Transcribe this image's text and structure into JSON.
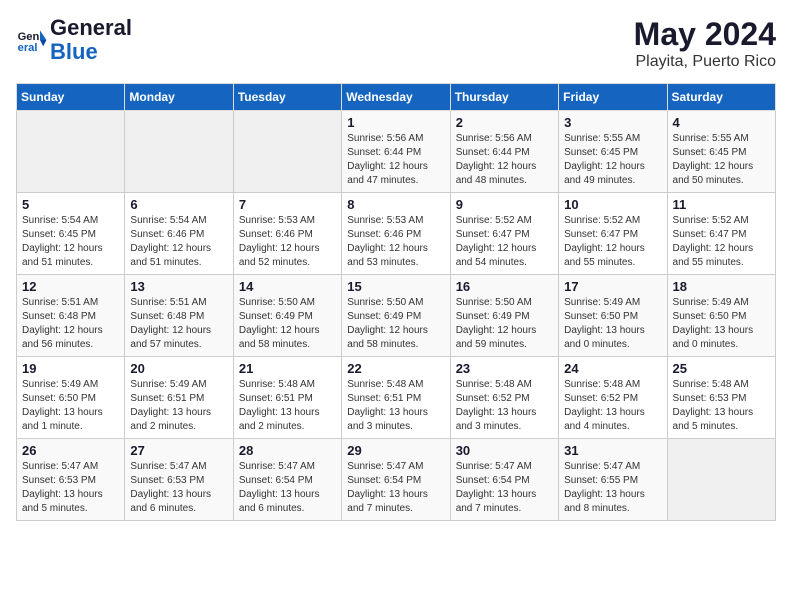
{
  "header": {
    "logo_general": "General",
    "logo_blue": "Blue",
    "month": "May 2024",
    "location": "Playita, Puerto Rico"
  },
  "days_of_week": [
    "Sunday",
    "Monday",
    "Tuesday",
    "Wednesday",
    "Thursday",
    "Friday",
    "Saturday"
  ],
  "weeks": [
    [
      {
        "day": "",
        "info": ""
      },
      {
        "day": "",
        "info": ""
      },
      {
        "day": "",
        "info": ""
      },
      {
        "day": "1",
        "info": "Sunrise: 5:56 AM\nSunset: 6:44 PM\nDaylight: 12 hours\nand 47 minutes."
      },
      {
        "day": "2",
        "info": "Sunrise: 5:56 AM\nSunset: 6:44 PM\nDaylight: 12 hours\nand 48 minutes."
      },
      {
        "day": "3",
        "info": "Sunrise: 5:55 AM\nSunset: 6:45 PM\nDaylight: 12 hours\nand 49 minutes."
      },
      {
        "day": "4",
        "info": "Sunrise: 5:55 AM\nSunset: 6:45 PM\nDaylight: 12 hours\nand 50 minutes."
      }
    ],
    [
      {
        "day": "5",
        "info": "Sunrise: 5:54 AM\nSunset: 6:45 PM\nDaylight: 12 hours\nand 51 minutes."
      },
      {
        "day": "6",
        "info": "Sunrise: 5:54 AM\nSunset: 6:46 PM\nDaylight: 12 hours\nand 51 minutes."
      },
      {
        "day": "7",
        "info": "Sunrise: 5:53 AM\nSunset: 6:46 PM\nDaylight: 12 hours\nand 52 minutes."
      },
      {
        "day": "8",
        "info": "Sunrise: 5:53 AM\nSunset: 6:46 PM\nDaylight: 12 hours\nand 53 minutes."
      },
      {
        "day": "9",
        "info": "Sunrise: 5:52 AM\nSunset: 6:47 PM\nDaylight: 12 hours\nand 54 minutes."
      },
      {
        "day": "10",
        "info": "Sunrise: 5:52 AM\nSunset: 6:47 PM\nDaylight: 12 hours\nand 55 minutes."
      },
      {
        "day": "11",
        "info": "Sunrise: 5:52 AM\nSunset: 6:47 PM\nDaylight: 12 hours\nand 55 minutes."
      }
    ],
    [
      {
        "day": "12",
        "info": "Sunrise: 5:51 AM\nSunset: 6:48 PM\nDaylight: 12 hours\nand 56 minutes."
      },
      {
        "day": "13",
        "info": "Sunrise: 5:51 AM\nSunset: 6:48 PM\nDaylight: 12 hours\nand 57 minutes."
      },
      {
        "day": "14",
        "info": "Sunrise: 5:50 AM\nSunset: 6:49 PM\nDaylight: 12 hours\nand 58 minutes."
      },
      {
        "day": "15",
        "info": "Sunrise: 5:50 AM\nSunset: 6:49 PM\nDaylight: 12 hours\nand 58 minutes."
      },
      {
        "day": "16",
        "info": "Sunrise: 5:50 AM\nSunset: 6:49 PM\nDaylight: 12 hours\nand 59 minutes."
      },
      {
        "day": "17",
        "info": "Sunrise: 5:49 AM\nSunset: 6:50 PM\nDaylight: 13 hours\nand 0 minutes."
      },
      {
        "day": "18",
        "info": "Sunrise: 5:49 AM\nSunset: 6:50 PM\nDaylight: 13 hours\nand 0 minutes."
      }
    ],
    [
      {
        "day": "19",
        "info": "Sunrise: 5:49 AM\nSunset: 6:50 PM\nDaylight: 13 hours\nand 1 minute."
      },
      {
        "day": "20",
        "info": "Sunrise: 5:49 AM\nSunset: 6:51 PM\nDaylight: 13 hours\nand 2 minutes."
      },
      {
        "day": "21",
        "info": "Sunrise: 5:48 AM\nSunset: 6:51 PM\nDaylight: 13 hours\nand 2 minutes."
      },
      {
        "day": "22",
        "info": "Sunrise: 5:48 AM\nSunset: 6:51 PM\nDaylight: 13 hours\nand 3 minutes."
      },
      {
        "day": "23",
        "info": "Sunrise: 5:48 AM\nSunset: 6:52 PM\nDaylight: 13 hours\nand 3 minutes."
      },
      {
        "day": "24",
        "info": "Sunrise: 5:48 AM\nSunset: 6:52 PM\nDaylight: 13 hours\nand 4 minutes."
      },
      {
        "day": "25",
        "info": "Sunrise: 5:48 AM\nSunset: 6:53 PM\nDaylight: 13 hours\nand 5 minutes."
      }
    ],
    [
      {
        "day": "26",
        "info": "Sunrise: 5:47 AM\nSunset: 6:53 PM\nDaylight: 13 hours\nand 5 minutes."
      },
      {
        "day": "27",
        "info": "Sunrise: 5:47 AM\nSunset: 6:53 PM\nDaylight: 13 hours\nand 6 minutes."
      },
      {
        "day": "28",
        "info": "Sunrise: 5:47 AM\nSunset: 6:54 PM\nDaylight: 13 hours\nand 6 minutes."
      },
      {
        "day": "29",
        "info": "Sunrise: 5:47 AM\nSunset: 6:54 PM\nDaylight: 13 hours\nand 7 minutes."
      },
      {
        "day": "30",
        "info": "Sunrise: 5:47 AM\nSunset: 6:54 PM\nDaylight: 13 hours\nand 7 minutes."
      },
      {
        "day": "31",
        "info": "Sunrise: 5:47 AM\nSunset: 6:55 PM\nDaylight: 13 hours\nand 8 minutes."
      },
      {
        "day": "",
        "info": ""
      }
    ]
  ]
}
